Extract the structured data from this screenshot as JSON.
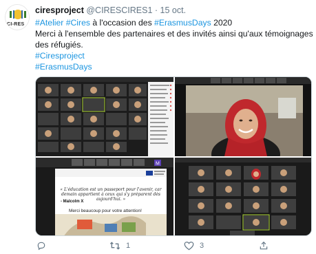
{
  "tweet": {
    "display_name": "ciresproject",
    "handle": "@CIRESCIRES1",
    "separator": "·",
    "date": "15 oct.",
    "line1_hashtags": [
      "#Atelier",
      "#Cires"
    ],
    "line1_text": " à l'occasion des ",
    "line1_hashtag3": "#ErasmusDays",
    "line1_year": " 2020",
    "line2": "Merci à l'ensemble des partenaires et des invités ainsi qu'aux témoignages",
    "line3": "des réfugiés.",
    "hashtag_ciresproject": "#Ciresproject",
    "hashtag_erasmusdays": "#ErasmusDays",
    "avatar_text": "CI-RES"
  },
  "media": {
    "slide_quote": "« L'éducation est un passeport pour l'avenir, car demain appartient à ceux qui s'y préparent dès aujourd'hui. »",
    "slide_author": "- Malcolm X",
    "slide_thanks": "Merci beaucoup pour votre attention!"
  },
  "actions": {
    "reply_icon": "reply-icon",
    "retweet_icon": "retweet-icon",
    "retweet_count": "1",
    "like_icon": "like-icon",
    "like_count": "3",
    "share_icon": "share-icon"
  },
  "colors": {
    "link": "#1b95e0",
    "muted": "#657786",
    "text": "#14171a"
  }
}
